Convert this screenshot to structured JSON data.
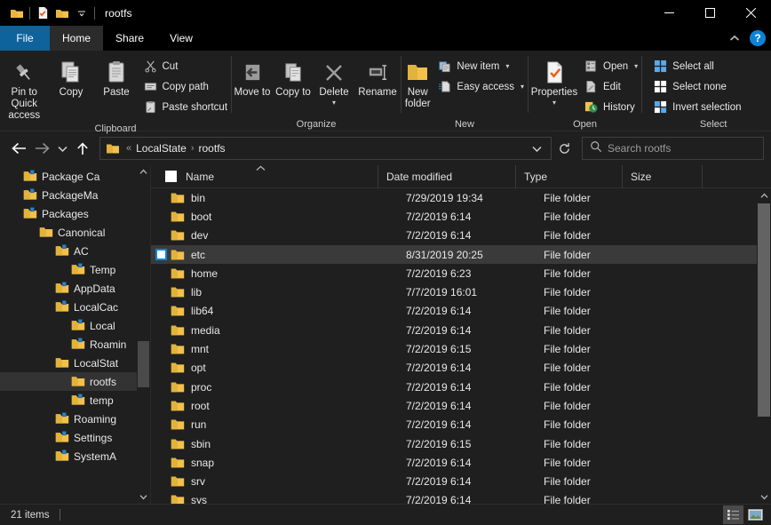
{
  "titlebar": {
    "title": "rootfs",
    "qat": [
      {
        "name": "folder-icon",
        "label": "Folder"
      },
      {
        "name": "properties-icon",
        "label": "Properties"
      },
      {
        "name": "new-folder-icon",
        "label": "New folder"
      },
      {
        "name": "customize-caret-icon",
        "label": "Customize Quick Access Toolbar"
      }
    ],
    "controls": [
      {
        "name": "minimize-button",
        "label": "Minimize"
      },
      {
        "name": "maximize-button",
        "label": "Maximize"
      },
      {
        "name": "close-button",
        "label": "Close"
      }
    ]
  },
  "tabs": {
    "items": [
      {
        "label": "File",
        "active": false,
        "file": true
      },
      {
        "label": "Home",
        "active": true,
        "file": false
      },
      {
        "label": "Share",
        "active": false,
        "file": false
      },
      {
        "label": "View",
        "active": false,
        "file": false
      }
    ],
    "collapse_label": "Minimize the Ribbon",
    "help_label": "?"
  },
  "ribbon": {
    "groups": [
      {
        "title": "Clipboard",
        "big": [
          {
            "label": "Pin to Quick access",
            "icon": "pin-icon",
            "caret": false
          },
          {
            "label": "Copy",
            "icon": "copy-icon",
            "caret": false
          },
          {
            "label": "Paste",
            "icon": "paste-icon",
            "caret": false
          }
        ],
        "small": [
          {
            "label": "Cut",
            "icon": "scissors-icon",
            "caret": false
          },
          {
            "label": "Copy path",
            "icon": "copy-path-icon",
            "caret": false
          },
          {
            "label": "Paste shortcut",
            "icon": "paste-shortcut-icon",
            "caret": false
          }
        ]
      },
      {
        "title": "Organize",
        "big": [
          {
            "label": "Move to",
            "icon": "move-to-icon",
            "caret": true
          },
          {
            "label": "Copy to",
            "icon": "copy-to-icon",
            "caret": true
          },
          {
            "label": "Delete",
            "icon": "delete-icon",
            "caret": true
          },
          {
            "label": "Rename",
            "icon": "rename-icon",
            "caret": false
          }
        ],
        "small": []
      },
      {
        "title": "New",
        "big": [
          {
            "label": "New folder",
            "icon": "new-folder-icon",
            "caret": false
          }
        ],
        "small": [
          {
            "label": "New item",
            "icon": "new-item-icon",
            "caret": true
          },
          {
            "label": "Easy access",
            "icon": "easy-access-icon",
            "caret": true
          }
        ]
      },
      {
        "title": "Open",
        "big": [
          {
            "label": "Properties",
            "icon": "properties-icon",
            "caret": true
          }
        ],
        "small": [
          {
            "label": "Open",
            "icon": "open-icon",
            "caret": true
          },
          {
            "label": "Edit",
            "icon": "edit-icon",
            "caret": false
          },
          {
            "label": "History",
            "icon": "history-icon",
            "caret": false
          }
        ]
      },
      {
        "title": "Select",
        "big": [],
        "small": [
          {
            "label": "Select all",
            "icon": "select-all-icon",
            "caret": false
          },
          {
            "label": "Select none",
            "icon": "select-none-icon",
            "caret": false
          },
          {
            "label": "Invert selection",
            "icon": "invert-selection-icon",
            "caret": false
          }
        ]
      }
    ]
  },
  "address": {
    "back_label": "Back",
    "forward_label": "Forward",
    "recent_label": "Recent locations",
    "up_label": "Up",
    "crumbs": [
      "LocalState",
      "rootfs"
    ],
    "overflow": "«",
    "separator": "›",
    "dropdown_label": "Previous locations",
    "refresh_label": "Refresh"
  },
  "search": {
    "placeholder": "Search rootfs",
    "value": ""
  },
  "sidebar": {
    "items": [
      {
        "label": "Package Ca",
        "indent": 1,
        "selected": false,
        "shortcut": true
      },
      {
        "label": "PackageMa",
        "indent": 1,
        "selected": false,
        "shortcut": true
      },
      {
        "label": "Packages",
        "indent": 1,
        "selected": false,
        "shortcut": true
      },
      {
        "label": "Canonical",
        "indent": 2,
        "selected": false,
        "shortcut": false
      },
      {
        "label": "AC",
        "indent": 3,
        "selected": false,
        "shortcut": true
      },
      {
        "label": "Temp",
        "indent": 4,
        "selected": false,
        "shortcut": true
      },
      {
        "label": "AppData",
        "indent": 3,
        "selected": false,
        "shortcut": true
      },
      {
        "label": "LocalCac",
        "indent": 3,
        "selected": false,
        "shortcut": true
      },
      {
        "label": "Local",
        "indent": 4,
        "selected": false,
        "shortcut": true
      },
      {
        "label": "Roamin",
        "indent": 4,
        "selected": false,
        "shortcut": true
      },
      {
        "label": "LocalStat",
        "indent": 3,
        "selected": false,
        "shortcut": false
      },
      {
        "label": "rootfs",
        "indent": 4,
        "selected": true,
        "shortcut": false
      },
      {
        "label": "temp",
        "indent": 4,
        "selected": false,
        "shortcut": true
      },
      {
        "label": "Roaming",
        "indent": 3,
        "selected": false,
        "shortcut": true
      },
      {
        "label": "Settings",
        "indent": 3,
        "selected": false,
        "shortcut": true
      },
      {
        "label": "SystemA",
        "indent": 3,
        "selected": false,
        "shortcut": true
      }
    ],
    "scroll_up_label": "Scroll up",
    "scroll_down_label": "Scroll down"
  },
  "filelist": {
    "columns": [
      {
        "key": "name",
        "label": "Name",
        "sorted": true,
        "sort_dir": "asc"
      },
      {
        "key": "date",
        "label": "Date modified",
        "sorted": false
      },
      {
        "key": "type",
        "label": "Type",
        "sorted": false
      },
      {
        "key": "size",
        "label": "Size",
        "sorted": false
      }
    ],
    "rows": [
      {
        "name": "bin",
        "date": "7/29/2019 19:34",
        "type": "File folder",
        "size": "",
        "selected": false
      },
      {
        "name": "boot",
        "date": "7/2/2019 6:14",
        "type": "File folder",
        "size": "",
        "selected": false
      },
      {
        "name": "dev",
        "date": "7/2/2019 6:14",
        "type": "File folder",
        "size": "",
        "selected": false
      },
      {
        "name": "etc",
        "date": "8/31/2019 20:25",
        "type": "File folder",
        "size": "",
        "selected": true
      },
      {
        "name": "home",
        "date": "7/2/2019 6:23",
        "type": "File folder",
        "size": "",
        "selected": false
      },
      {
        "name": "lib",
        "date": "7/7/2019 16:01",
        "type": "File folder",
        "size": "",
        "selected": false
      },
      {
        "name": "lib64",
        "date": "7/2/2019 6:14",
        "type": "File folder",
        "size": "",
        "selected": false
      },
      {
        "name": "media",
        "date": "7/2/2019 6:14",
        "type": "File folder",
        "size": "",
        "selected": false
      },
      {
        "name": "mnt",
        "date": "7/2/2019 6:15",
        "type": "File folder",
        "size": "",
        "selected": false
      },
      {
        "name": "opt",
        "date": "7/2/2019 6:14",
        "type": "File folder",
        "size": "",
        "selected": false
      },
      {
        "name": "proc",
        "date": "7/2/2019 6:14",
        "type": "File folder",
        "size": "",
        "selected": false
      },
      {
        "name": "root",
        "date": "7/2/2019 6:14",
        "type": "File folder",
        "size": "",
        "selected": false
      },
      {
        "name": "run",
        "date": "7/2/2019 6:14",
        "type": "File folder",
        "size": "",
        "selected": false
      },
      {
        "name": "sbin",
        "date": "7/2/2019 6:15",
        "type": "File folder",
        "size": "",
        "selected": false
      },
      {
        "name": "snap",
        "date": "7/2/2019 6:14",
        "type": "File folder",
        "size": "",
        "selected": false
      },
      {
        "name": "srv",
        "date": "7/2/2019 6:14",
        "type": "File folder",
        "size": "",
        "selected": false
      },
      {
        "name": "sys",
        "date": "7/2/2019 6:14",
        "type": "File folder",
        "size": "",
        "selected": false
      }
    ],
    "scroll_up_label": "Scroll up",
    "scroll_down_label": "Scroll down"
  },
  "statusbar": {
    "item_count": "21 items",
    "views": [
      {
        "name": "details-view-button",
        "label": "Details view",
        "active": true
      },
      {
        "name": "large-icons-view-button",
        "label": "Large icons view",
        "active": false
      }
    ]
  },
  "colors": {
    "window_bg": "#1f1f1f",
    "titlebar_bg": "#000000",
    "file_tab_blue": "#0e639c",
    "accent_blue": "#0a84d8",
    "folder_yellow": "#f2c14b",
    "selection_row": "#3a3a3a",
    "selection_tree": "#333333",
    "text": "#e8e8e8"
  }
}
